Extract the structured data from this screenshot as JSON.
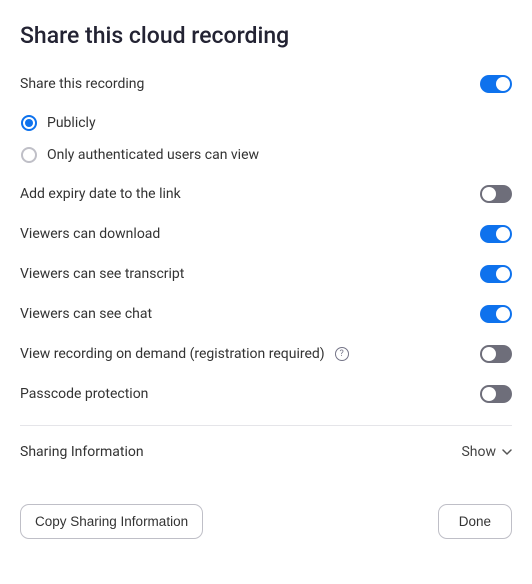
{
  "title": "Share this cloud recording",
  "share_toggle": {
    "label": "Share this recording",
    "value": true
  },
  "visibility": {
    "options": [
      {
        "label": "Publicly",
        "selected": true
      },
      {
        "label": "Only authenticated users can view",
        "selected": false
      }
    ]
  },
  "settings": [
    {
      "key": "expiry",
      "label": "Add expiry date to the link",
      "value": false,
      "help": false
    },
    {
      "key": "download",
      "label": "Viewers can download",
      "value": true,
      "help": false
    },
    {
      "key": "transcript",
      "label": "Viewers can see transcript",
      "value": true,
      "help": false
    },
    {
      "key": "chat",
      "label": "Viewers can see chat",
      "value": true,
      "help": false
    },
    {
      "key": "ondemand",
      "label": "View recording on demand (registration required)",
      "value": false,
      "help": true
    },
    {
      "key": "passcode",
      "label": "Passcode protection",
      "value": false,
      "help": false
    }
  ],
  "sharing_info": {
    "label": "Sharing Information",
    "toggle_label": "Show"
  },
  "buttons": {
    "copy": "Copy Sharing Information",
    "done": "Done"
  }
}
